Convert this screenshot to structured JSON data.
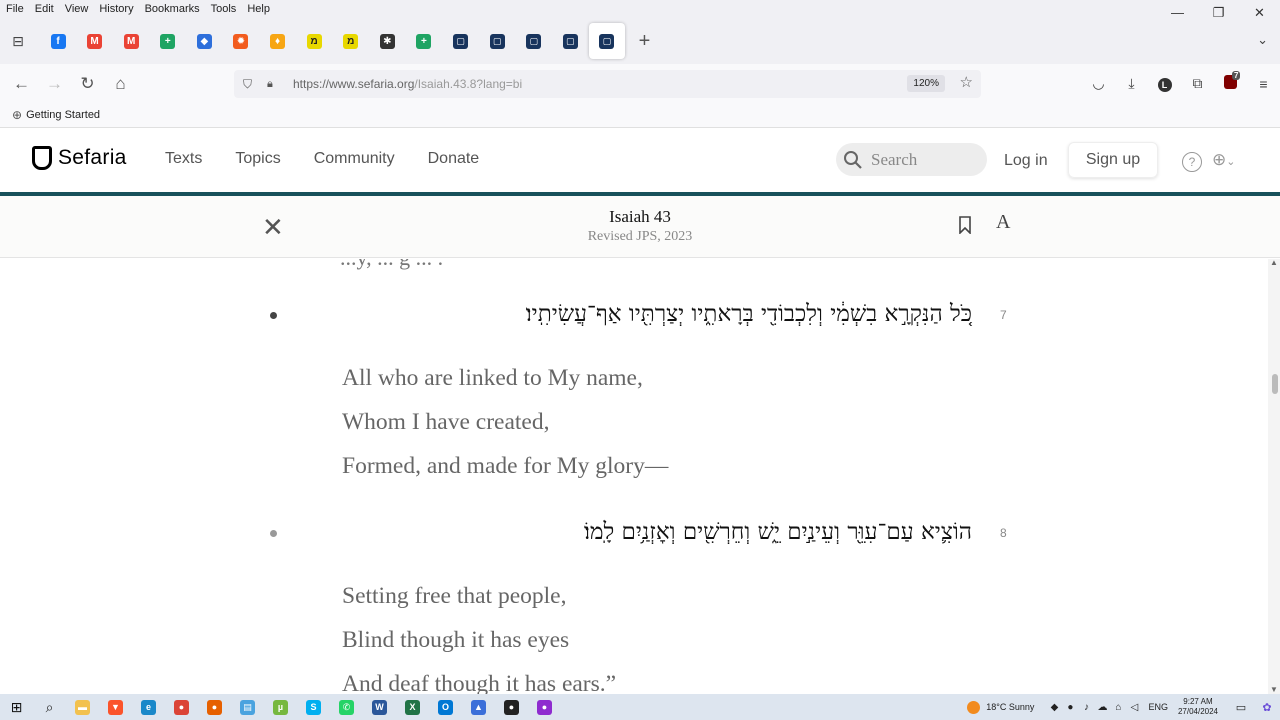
{
  "browser": {
    "menu": [
      "File",
      "Edit",
      "View",
      "History",
      "Bookmarks",
      "Tools",
      "Help"
    ],
    "window_controls": {
      "minimize": "—",
      "restore": "❐",
      "close": "✕"
    },
    "tabs": [
      {
        "icon": "facebook-icon",
        "color": "#1877f2",
        "glyph": "f"
      },
      {
        "icon": "gmail-icon",
        "color": "#ea4335",
        "glyph": "M"
      },
      {
        "icon": "gmail-icon",
        "color": "#ea4335",
        "glyph": "M"
      },
      {
        "icon": "sheets-icon",
        "color": "#1fa463",
        "glyph": "+"
      },
      {
        "icon": "shield-icon",
        "color": "#2e6fdb",
        "glyph": "◆"
      },
      {
        "icon": "orange-sun-icon",
        "color": "#f25c1e",
        "glyph": "✹"
      },
      {
        "icon": "flame-icon",
        "color": "#f7a614",
        "glyph": "♦"
      },
      {
        "icon": "hebrew-mem-icon",
        "color": "#e8d800",
        "glyph": "מ"
      },
      {
        "icon": "hebrew-mem-icon",
        "color": "#e8d800",
        "glyph": "מ"
      },
      {
        "icon": "puzzle-gear-icon",
        "color": "#333333",
        "glyph": "✱"
      },
      {
        "icon": "sheets-icon",
        "color": "#1fa463",
        "glyph": "+"
      },
      {
        "icon": "sefaria-icon",
        "color": "#18345d",
        "glyph": "▢"
      },
      {
        "icon": "sefaria-icon",
        "color": "#18345d",
        "glyph": "▢"
      },
      {
        "icon": "sefaria-icon",
        "color": "#18345d",
        "glyph": "▢"
      },
      {
        "icon": "sefaria-icon",
        "color": "#18345d",
        "glyph": "▢"
      },
      {
        "icon": "sefaria-icon",
        "color": "#18345d",
        "glyph": "▢",
        "active": true
      }
    ],
    "new_tab": "+",
    "url": "https://www.sefaria.org/Isaiah.43.8?lang=bi",
    "url_host": "https://www.sefaria.org",
    "url_path": "/Isaiah.43.8?lang=bi",
    "zoom": "120%",
    "bookmarks": [
      "Getting Started"
    ],
    "extension_badge": "7"
  },
  "sefaria": {
    "logo": "Sefaria",
    "nav": [
      "Texts",
      "Topics",
      "Community",
      "Donate"
    ],
    "search_placeholder": "Search",
    "login": "Log in",
    "signup": "Sign up",
    "help": "?",
    "brand_color": "#18515b"
  },
  "reader": {
    "title": "Isaiah 43",
    "subtitle": "Revised JPS, 2023",
    "font_button": "A",
    "cut_line": "...y, ... g ... ."
  },
  "verses": [
    {
      "number": "7",
      "hebrew": "כֹּ֚ל הַנִּקְרָ֣א בִשְׁמִ֔י וְלִכְבוֹדִ֖י בְּרָאתִ֑יו יְצַרְתִּ֖יו אַף־עֲשִׂיתִֽיו׃",
      "english": [
        "All who are linked to My name,",
        "Whom I have created,",
        "Formed, and made for My glory—"
      ]
    },
    {
      "number": "8",
      "hebrew": "הוֹצִ֛יא עַם־עִוֵּ֖ר וְעֵינַ֣יִם יֵ֑שׁ וְחֵרְשִׁ֖ים וְאׇזְנַ֥יִם לָֽמוֹ׃",
      "english": [
        "Setting free that people,",
        "Blind though it has eyes",
        "And deaf though it has ears.”"
      ]
    }
  ],
  "taskbar": {
    "apps": [
      {
        "icon": "file-explorer-icon",
        "color": "#f2c14e",
        "glyph": "▬"
      },
      {
        "icon": "brave-icon",
        "color": "#fb542b",
        "glyph": "▼"
      },
      {
        "icon": "edge-icon",
        "color": "#1a88c9",
        "glyph": "e"
      },
      {
        "icon": "chrome-icon",
        "color": "#db4437",
        "glyph": "●"
      },
      {
        "icon": "firefox-icon",
        "color": "#e66000",
        "glyph": "●"
      },
      {
        "icon": "window-app-icon",
        "color": "#4aa3df",
        "glyph": "▤"
      },
      {
        "icon": "utorrent-icon",
        "color": "#76b83f",
        "glyph": "µ"
      },
      {
        "icon": "skype-icon",
        "color": "#00aff0",
        "glyph": "S"
      },
      {
        "icon": "whatsapp-icon",
        "color": "#25d366",
        "glyph": "✆"
      },
      {
        "icon": "word-icon",
        "color": "#2b579a",
        "glyph": "W"
      },
      {
        "icon": "excel-icon",
        "color": "#217346",
        "glyph": "X"
      },
      {
        "icon": "outlook-icon",
        "color": "#0078d4",
        "glyph": "O"
      },
      {
        "icon": "arc-icon",
        "color": "#3b6fd9",
        "glyph": "▲"
      },
      {
        "icon": "red-dot-icon",
        "color": "#222222",
        "glyph": "●"
      },
      {
        "icon": "purple-app-icon",
        "color": "#8e2bcf",
        "glyph": "●"
      }
    ],
    "weather": "18°C  Sunny",
    "lang": "ENG",
    "time": "9:27 AM",
    "date": "27/04/2024"
  }
}
